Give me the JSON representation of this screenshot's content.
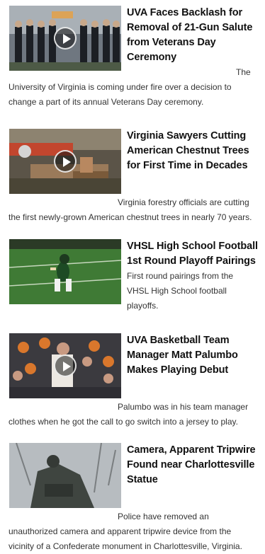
{
  "stories": [
    {
      "title": "UVA Faces Backlash for Removal of 21-Gun Salute from Veterans Day Ceremony",
      "summary": "The University of Virginia is coming under fire over a decision to change a part of its annual Veterans Day ceremony.",
      "has_video": true,
      "thumb_icon": "honor-guard-photo"
    },
    {
      "title": "Virginia Sawyers Cutting American Chestnut Trees for First Time in Decades",
      "summary": "Virginia forestry officials are cutting the first newly-grown American chestnut trees in nearly 70 years.",
      "has_video": true,
      "thumb_icon": "sawmill-photo"
    },
    {
      "title": "VHSL High School Football 1st Round Playoff Pairings",
      "summary": "First round pairings from the VHSL High School football playoffs.",
      "has_video": false,
      "thumb_icon": "football-player-photo"
    },
    {
      "title": "UVA Basketball Team Manager Matt Palumbo Makes Playing Debut",
      "summary": "Palumbo was in his team manager clothes when he got the call to go switch into a jersey to play.",
      "has_video": true,
      "thumb_icon": "basketball-crowd-photo"
    },
    {
      "title": "Camera, Apparent Tripwire Found near Charlottesville Statue",
      "summary": "Police have removed an unauthorized camera and apparent tripwire device from the vicinity of a Confederate monument in Charlottesville, Virginia.",
      "has_video": false,
      "thumb_icon": "statue-photo"
    }
  ]
}
